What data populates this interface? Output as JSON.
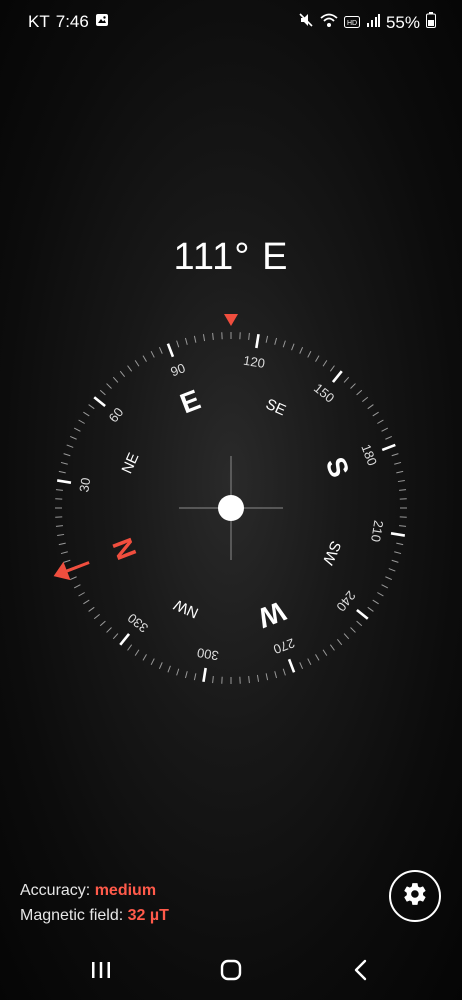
{
  "status_bar": {
    "carrier": "KT",
    "time": "7:46",
    "battery": "55%",
    "icons": [
      "image-icon",
      "mute-icon",
      "wifi-icon",
      "hd-icon",
      "signal-icon",
      "battery-icon"
    ]
  },
  "heading": {
    "degrees": "111°",
    "direction": "E"
  },
  "compass": {
    "heading_deg": 111,
    "cardinals": [
      "N",
      "E",
      "S",
      "W"
    ],
    "intercardinals": [
      "NE",
      "SE",
      "SW",
      "NW"
    ],
    "degree_labels": [
      "30",
      "60",
      "90",
      "120",
      "150",
      "180",
      "210",
      "240",
      "270",
      "300",
      "330"
    ],
    "accent_color": "#f04e3e",
    "marker_icon": "triangle-down-icon"
  },
  "info": {
    "accuracy_label": "Accuracy:",
    "accuracy_value": "medium",
    "magnetic_label": "Magnetic field:",
    "magnetic_value": "32 µT"
  },
  "settings": {
    "icon": "gear-icon"
  },
  "nav": {
    "icons": [
      "recent-apps-icon",
      "home-icon",
      "back-icon"
    ]
  }
}
